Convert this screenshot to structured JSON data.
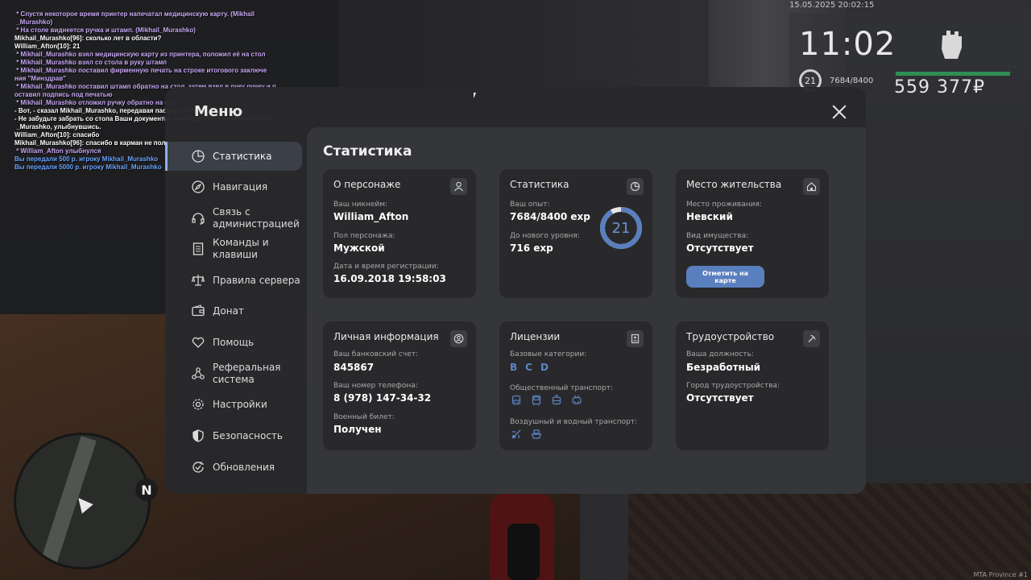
{
  "hud": {
    "datetime": "15.05.2025 20:02:15",
    "time": "11:02",
    "level": "21",
    "exp": "7684/8400",
    "money": "559 377₽",
    "exp_progress": 0.915,
    "bar_color": "#2e8f52"
  },
  "chat": [
    {
      "text": " * Спустя некоторое время принтер напечатал медицинскую карту. (Mikhail",
      "color": "me"
    },
    {
      "text": " _Murashko)",
      "color": "me"
    },
    {
      "text": " * На столе виднеется ручка и штамп. (Mikhail_Murashko)",
      "color": "me"
    },
    {
      "text": "Mikhail_Murashko[96]: сколько лет в области?",
      "color": "w"
    },
    {
      "text": "William_Afton[10]: 21",
      "color": "w"
    },
    {
      "text": " * Mikhail_Murashko взял медицинскую карту из принтера, положил её на стол",
      "color": "me"
    },
    {
      "text": " * Mikhail_Murashko взял со стола в руку штамп",
      "color": "me"
    },
    {
      "text": " * Mikhail_Murashko поставил фирменную печать на строке итогового заключе",
      "color": "me"
    },
    {
      "text": "ния \"Минздрав\"",
      "color": "me"
    },
    {
      "text": " * Mikhail_Murashko поставил штамп обратно на стол, затем взял в руку ручку и п",
      "color": "me"
    },
    {
      "text": "оставил подпись под печатью",
      "color": "me"
    },
    {
      "text": " * Mikhail_Murashko отложил ручку обратно на стол",
      "color": "me"
    },
    {
      "text": "- Вот, - сказал Mikhail_Murashko, передавая паспорт человеку напротив.",
      "color": "w"
    },
    {
      "text": "- Не забудьте забрать со стола Ваши документы, всего доброго, - сказал Mikhail",
      "color": "w"
    },
    {
      "text": " _Murashko, улыбнувшись.",
      "color": "w"
    },
    {
      "text": "William_Afton[10]: спасибо",
      "color": "w"
    },
    {
      "text": "Mikhail_Murashko[96]: спасибо в карман не положишь",
      "color": "w"
    },
    {
      "text": " * William_Afton улыбнулся",
      "color": "me"
    },
    {
      "text": "Вы передали 500 р. игроку Mikhail_Murashko",
      "color": "b"
    },
    {
      "text": "Вы передали 5000 р. игроку Mikhail_Murashko",
      "color": "b"
    }
  ],
  "menu": {
    "title": "Меню",
    "nav": [
      {
        "label": "Статистика",
        "icon": "pie-chart-icon",
        "active": true
      },
      {
        "label": "Навигация",
        "icon": "compass-icon"
      },
      {
        "label": "Связь с\nадминистрацией",
        "icon": "headset-icon"
      },
      {
        "label": "Команды и\nклавиши",
        "icon": "document-list-icon"
      },
      {
        "label": "Правила сервера",
        "icon": "scales-icon"
      },
      {
        "label": "Донат",
        "icon": "wallet-icon"
      },
      {
        "label": "Помощь",
        "icon": "heart-hand-icon"
      },
      {
        "label": "Реферальная\nсистема",
        "icon": "network-icon"
      },
      {
        "label": "Настройки",
        "icon": "gear-icon"
      },
      {
        "label": "Безопасность",
        "icon": "shield-icon"
      },
      {
        "label": "Обновления",
        "icon": "refresh-check-icon"
      }
    ],
    "content_title": "Статистика",
    "cards": {
      "character": {
        "title": "О персонаже",
        "nick_label": "Ваш никнейм:",
        "nick": "William_Afton",
        "gender_label": "Пол персонажа:",
        "gender": "Мужской",
        "reg_label": "Дата и время регистрации:",
        "reg": "16.09.2018 19:58:03"
      },
      "stats": {
        "title": "Статистика",
        "exp_label": "Ваш опыт:",
        "exp": "7684/8400 exp",
        "next_label": "До нового уровня:",
        "next": "716 exp",
        "level": "21",
        "level_progress": 0.915,
        "accent": "#5a7fbf"
      },
      "residence": {
        "title": "Место жительства",
        "place_label": "Место проживания:",
        "place": "Невский",
        "property_label": "Вид имущества:",
        "property": "Отсутствует",
        "map_button": "Отметить на карте"
      },
      "personal": {
        "title": "Личная информация",
        "bank_label": "Ваш банковский счет:",
        "bank": "845867",
        "phone_label": "Ваш номер телефона:",
        "phone": "8 (978) 147-34-32",
        "military_label": "Военный билет:",
        "military": "Получен"
      },
      "licenses": {
        "title": "Лицензии",
        "base_label": "Базовые категории:",
        "base": [
          "B",
          "C",
          "D"
        ],
        "public_label": "Общественный транспорт:",
        "public_icons": [
          "bus-icon",
          "bus-front-icon",
          "tram-icon",
          "trolleybus-icon"
        ],
        "air_label": "Воздушный и водный транспорт:",
        "air_icons": [
          "plane-icon",
          "ship-icon"
        ]
      },
      "job": {
        "title": "Трудоустройство",
        "position_label": "Ваша должность:",
        "position": "Безработный",
        "city_label": "Город трудоустройства:",
        "city": "Отсутствует"
      }
    }
  },
  "minimap": {
    "north": "N"
  },
  "watermark": "MTA Province #1"
}
